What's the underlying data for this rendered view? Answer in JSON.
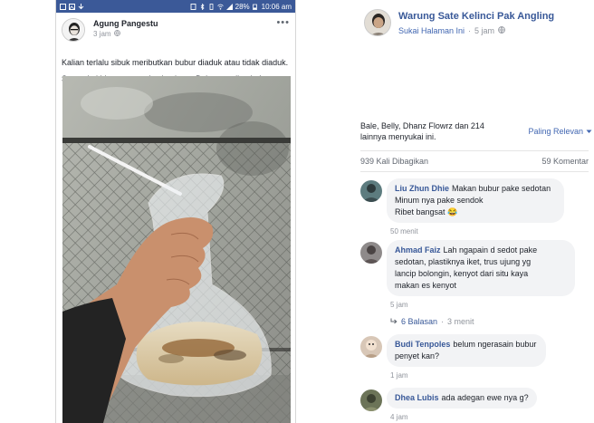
{
  "phone": {
    "status_bar": {
      "battery": "28%",
      "time": "10:06 am"
    },
    "post": {
      "author": "Agung Pangestu",
      "time": "3 jam",
      "more": "•••",
      "text_line1": "Kalian terlalu sibuk meributkan bubur diaduk atau tidak diaduk.",
      "text_line2": "Sampai akhirnya muncul sekte baru: Buburnya disedot!"
    }
  },
  "page": {
    "name": "Warung Sate Kelinci Pak Angling",
    "subtitle_link": "Sukai Halaman Ini",
    "dot": "·",
    "time": "5 jam"
  },
  "reactions": {
    "likes_text": "Bale, Belly, Dhanz Flowrz dan 214 lainnya menyukai ini.",
    "sort_label": "Paling Relevan"
  },
  "stats": {
    "shares": "939 Kali Dibagikan",
    "comments": "59 Komentar"
  },
  "comments": [
    {
      "name": "Liu Zhun Dhie",
      "text": "Makan bubur pake sedotan Minum nya pake sendok Ribet bangsat 😂",
      "line1": "Makan bubur pake sedotan",
      "line2": "Minum nya pake sendok",
      "line3": "Ribet bangsat 😂",
      "time": "50 menit"
    },
    {
      "name": "Ahmad Faiz",
      "line1": "Lah ngapain d sedot pake",
      "line2": "sedotan, plastiknya iket, trus ujung yg",
      "line3": "lancip bolongin, kenyot dari situ kaya",
      "line4": "makan es kenyot",
      "time": "5 jam",
      "replies_label": "6 Balasan",
      "replies_dot": "·",
      "replies_time": "3 menit"
    },
    {
      "name": "Budi Tenpoles",
      "line1": "belum ngerasain bubur",
      "line2": "penyet kan?",
      "time": "1 jam"
    },
    {
      "name": "Dhea Lubis",
      "line1": "ada adegan ewe nya g?",
      "time": "4 jam"
    }
  ]
}
